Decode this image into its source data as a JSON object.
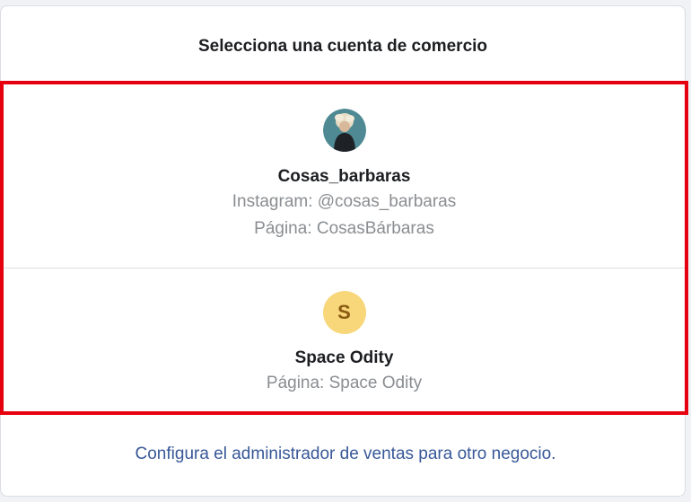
{
  "dialog": {
    "title": "Selecciona una cuenta de comercio",
    "highlight_color": "#e6000f"
  },
  "accounts": [
    {
      "name": "Cosas_barbaras",
      "avatar": "profile-photo",
      "instagram": "Instagram: @cosas_barbaras",
      "page": "Página: CosasBárbaras"
    },
    {
      "name": "Space Odity",
      "avatar_letter": "S",
      "avatar_color": "#f7d779",
      "page": "Página: Space Odity"
    }
  ],
  "footer": {
    "link_text": "Configura el administrador de ventas para otro negocio."
  }
}
